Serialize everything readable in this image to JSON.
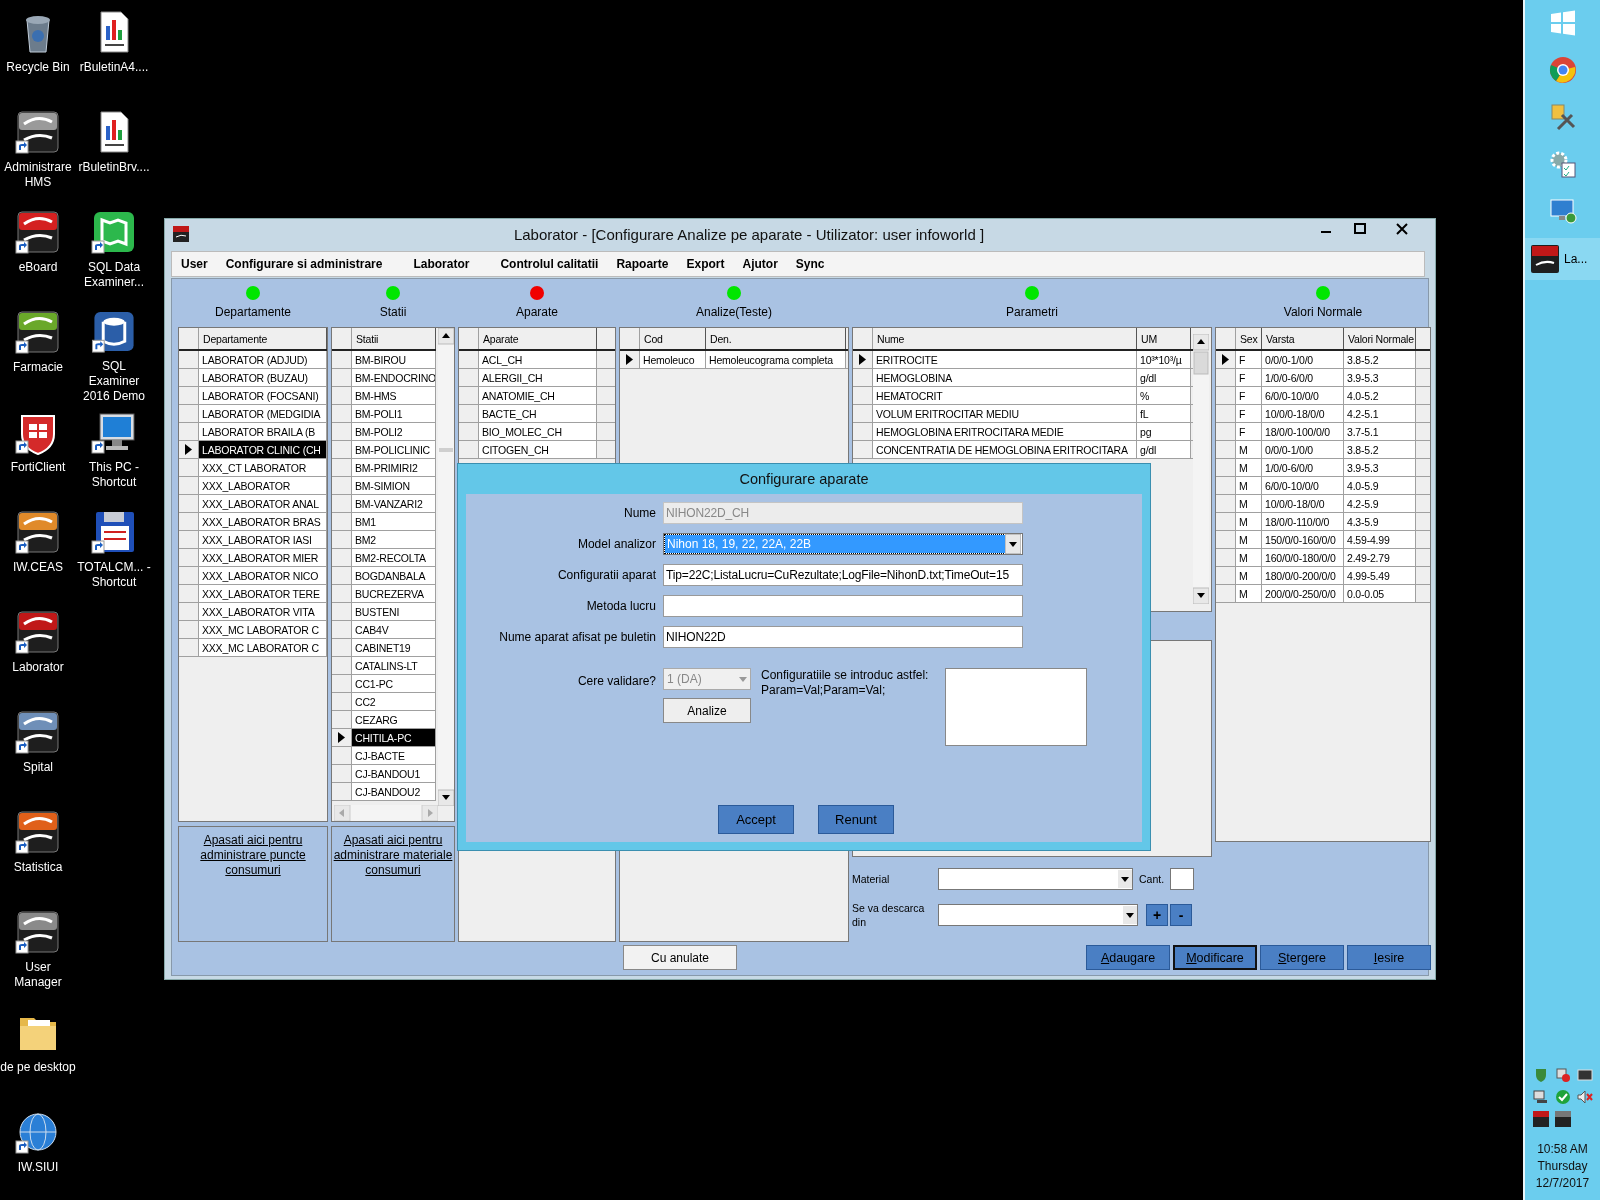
{
  "desktop": {
    "icons_column_1": [
      {
        "label": "Recycle Bin",
        "kind": "recycle",
        "shortcut": false
      },
      {
        "label": "Administrare HMS",
        "kind": "infoworld",
        "color": "#9a9a9a",
        "shortcut": true
      },
      {
        "label": "eBoard",
        "kind": "infoworld",
        "color": "#d42020",
        "shortcut": true
      },
      {
        "label": "Farmacie",
        "kind": "infoworld",
        "color": "#6aa82a",
        "shortcut": true
      },
      {
        "label": "FortiClient",
        "kind": "forticlient",
        "shortcut": true
      },
      {
        "label": "IW.CEAS",
        "kind": "infoworld",
        "color": "#e08a2a",
        "shortcut": true
      },
      {
        "label": "Laborator",
        "kind": "infoworld",
        "color": "#c01818",
        "shortcut": true
      },
      {
        "label": "Spital",
        "kind": "infoworld",
        "color": "#6f8fb8",
        "shortcut": true
      },
      {
        "label": "Statistica",
        "kind": "infoworld",
        "color": "#e0601a",
        "shortcut": true
      },
      {
        "label": "User Manager",
        "kind": "infoworld",
        "color": "#8a8a8a",
        "shortcut": true
      },
      {
        "label": "de pe desktop",
        "kind": "folder",
        "shortcut": false
      },
      {
        "label": "IW.SIUI",
        "kind": "globe",
        "shortcut": true
      }
    ],
    "icons_column_2": [
      {
        "label": "rBuletinA4....",
        "kind": "document",
        "shortcut": false
      },
      {
        "label": "rBuletinBrv....",
        "kind": "document",
        "shortcut": false
      },
      {
        "label": "SQL Data Examiner...",
        "kind": "sql-data",
        "shortcut": true
      },
      {
        "label": "SQL Examiner 2016 Demo",
        "kind": "sql-examiner",
        "shortcut": true
      },
      {
        "label": "This PC - Shortcut",
        "kind": "pc",
        "shortcut": true
      },
      {
        "label": "TOTALCM... - Shortcut",
        "kind": "floppy",
        "shortcut": true
      }
    ]
  },
  "window": {
    "title": "Laborator - [Configurare Analize pe aparate - Utilizator: user infoworld ]",
    "menu": [
      "User",
      "Configurare si administrare",
      "Laborator",
      "Controlul calitatii",
      "Rapoarte",
      "Export",
      "Ajutor",
      "Sync"
    ],
    "sections": [
      {
        "label": "Departamente",
        "color": "#00e600"
      },
      {
        "label": "Statii",
        "color": "#00e600"
      },
      {
        "label": "Aparate",
        "color": "#f00000"
      },
      {
        "label": "Analize(Teste)",
        "color": "#00e600"
      },
      {
        "label": "Parametri",
        "color": "#00e600"
      },
      {
        "label": "Valori Normale",
        "color": "#00e600"
      }
    ],
    "departamente": {
      "columns": [
        "Departamente"
      ],
      "rows": [
        {
          "cells": [
            "LABORATOR (ADJUD)"
          ],
          "selected": false,
          "highlighted": false
        },
        {
          "cells": [
            "LABORATOR (BUZAU)"
          ],
          "selected": false,
          "highlighted": false
        },
        {
          "cells": [
            "LABORATOR (FOCSANI)"
          ],
          "selected": false,
          "highlighted": false
        },
        {
          "cells": [
            "LABORATOR (MEDGIDIA"
          ],
          "selected": false,
          "highlighted": false
        },
        {
          "cells": [
            "LABORATOR BRAILA (B"
          ],
          "selected": false,
          "highlighted": false
        },
        {
          "cells": [
            "LABORATOR CLINIC (CH"
          ],
          "selected": true,
          "highlighted": true
        },
        {
          "cells": [
            "XXX_CT LABORATOR"
          ],
          "selected": false,
          "highlighted": false
        },
        {
          "cells": [
            "XXX_LABORATOR"
          ],
          "selected": false,
          "highlighted": false
        },
        {
          "cells": [
            "XXX_LABORATOR ANAL"
          ],
          "selected": false,
          "highlighted": false
        },
        {
          "cells": [
            "XXX_LABORATOR BRAS"
          ],
          "selected": false,
          "highlighted": false
        },
        {
          "cells": [
            "XXX_LABORATOR IASI"
          ],
          "selected": false,
          "highlighted": false
        },
        {
          "cells": [
            "XXX_LABORATOR MIER"
          ],
          "selected": false,
          "highlighted": false
        },
        {
          "cells": [
            "XXX_LABORATOR NICO"
          ],
          "selected": false,
          "highlighted": false
        },
        {
          "cells": [
            "XXX_LABORATOR TERE"
          ],
          "selected": false,
          "highlighted": false
        },
        {
          "cells": [
            "XXX_LABORATOR VITA"
          ],
          "selected": false,
          "highlighted": false
        },
        {
          "cells": [
            "XXX_MC LABORATOR C"
          ],
          "selected": false,
          "highlighted": false
        },
        {
          "cells": [
            "XXX_MC LABORATOR C"
          ],
          "selected": false,
          "highlighted": false
        }
      ]
    },
    "departamente_link": "Apasati aici pentru administrare puncte consumuri",
    "statii": {
      "columns": [
        "Statii"
      ],
      "rows": [
        {
          "cells": [
            "BM-BIROU"
          ],
          "selected": false,
          "highlighted": false
        },
        {
          "cells": [
            "BM-ENDOCRINO"
          ],
          "selected": false,
          "highlighted": false
        },
        {
          "cells": [
            "BM-HMS"
          ],
          "selected": false,
          "highlighted": false
        },
        {
          "cells": [
            "BM-POLI1"
          ],
          "selected": false,
          "highlighted": false
        },
        {
          "cells": [
            "BM-POLI2"
          ],
          "selected": false,
          "highlighted": false
        },
        {
          "cells": [
            "BM-POLICLINIC"
          ],
          "selected": false,
          "highlighted": false
        },
        {
          "cells": [
            "BM-PRIMIRI2"
          ],
          "selected": false,
          "highlighted": false
        },
        {
          "cells": [
            "BM-SIMION"
          ],
          "selected": false,
          "highlighted": false
        },
        {
          "cells": [
            "BM-VANZARI2"
          ],
          "selected": false,
          "highlighted": false
        },
        {
          "cells": [
            "BM1"
          ],
          "selected": false,
          "highlighted": false
        },
        {
          "cells": [
            "BM2"
          ],
          "selected": false,
          "highlighted": false
        },
        {
          "cells": [
            "BM2-RECOLTA"
          ],
          "selected": false,
          "highlighted": false
        },
        {
          "cells": [
            "BOGDANBALA"
          ],
          "selected": false,
          "highlighted": false
        },
        {
          "cells": [
            "BUCREZERVA"
          ],
          "selected": false,
          "highlighted": false
        },
        {
          "cells": [
            "BUSTENI"
          ],
          "selected": false,
          "highlighted": false
        },
        {
          "cells": [
            "CAB4V"
          ],
          "selected": false,
          "highlighted": false
        },
        {
          "cells": [
            "CABINET19"
          ],
          "selected": false,
          "highlighted": false
        },
        {
          "cells": [
            "CATALINS-LT"
          ],
          "selected": false,
          "highlighted": false
        },
        {
          "cells": [
            "CC1-PC"
          ],
          "selected": false,
          "highlighted": false
        },
        {
          "cells": [
            "CC2"
          ],
          "selected": false,
          "highlighted": false
        },
        {
          "cells": [
            "CEZARG"
          ],
          "selected": false,
          "highlighted": false
        },
        {
          "cells": [
            "CHITILA-PC"
          ],
          "selected": true,
          "highlighted": true
        },
        {
          "cells": [
            "CJ-BACTE"
          ],
          "selected": false,
          "highlighted": false
        },
        {
          "cells": [
            "CJ-BANDOU1"
          ],
          "selected": false,
          "highlighted": false
        },
        {
          "cells": [
            "CJ-BANDOU2"
          ],
          "selected": false,
          "highlighted": false
        }
      ]
    },
    "statii_link": "Apasati aici pentru administrare materiale consumuri",
    "aparate": {
      "columns": [
        "Aparate"
      ],
      "rows": [
        {
          "cells": [
            "ACL_CH"
          ],
          "selected": false
        },
        {
          "cells": [
            "ALERGII_CH"
          ],
          "selected": false
        },
        {
          "cells": [
            "ANATOMIE_CH"
          ],
          "selected": false
        },
        {
          "cells": [
            "BACTE_CH"
          ],
          "selected": false
        },
        {
          "cells": [
            "BIO_MOLEC_CH"
          ],
          "selected": false
        },
        {
          "cells": [
            "CITOGEN_CH"
          ],
          "selected": false
        }
      ]
    },
    "analize": {
      "columns": [
        "Cod",
        "Den."
      ],
      "rows": [
        {
          "cells": [
            "Hemoleuco",
            "Hemoleucograma completa"
          ],
          "selected": true
        }
      ]
    },
    "parametri": {
      "columns": [
        "Nume",
        "UM"
      ],
      "rows": [
        {
          "cells": [
            "ERITROCITE",
            "10³*10³/µ"
          ],
          "selected": true
        },
        {
          "cells": [
            "HEMOGLOBINA",
            "g/dl"
          ],
          "selected": false
        },
        {
          "cells": [
            "HEMATOCRIT",
            "%"
          ],
          "selected": false
        },
        {
          "cells": [
            "VOLUM ERITROCITAR MEDIU",
            "fL"
          ],
          "selected": false
        },
        {
          "cells": [
            "HEMOGLOBINA ERITROCITARA MEDIE",
            "pg"
          ],
          "selected": false
        },
        {
          "cells": [
            "CONCENTRATIA DE HEMOGLOBINA ERITROCITARA",
            "g/dl"
          ],
          "selected": false
        }
      ]
    },
    "valori": {
      "columns": [
        "Sex",
        "Varsta",
        "Valori Normale"
      ],
      "rows": [
        {
          "cells": [
            "F",
            "0/0/0-1/0/0",
            "3.8-5.2"
          ],
          "selected": true
        },
        {
          "cells": [
            "F",
            "1/0/0-6/0/0",
            "3.9-5.3"
          ],
          "selected": false
        },
        {
          "cells": [
            "F",
            "6/0/0-10/0/0",
            "4.0-5.2"
          ],
          "selected": false
        },
        {
          "cells": [
            "F",
            "10/0/0-18/0/0",
            "4.2-5.1"
          ],
          "selected": false
        },
        {
          "cells": [
            "F",
            "18/0/0-100/0/0",
            "3.7-5.1"
          ],
          "selected": false
        },
        {
          "cells": [
            "M",
            "0/0/0-1/0/0",
            "3.8-5.2"
          ],
          "selected": false
        },
        {
          "cells": [
            "M",
            "1/0/0-6/0/0",
            "3.9-5.3"
          ],
          "selected": false
        },
        {
          "cells": [
            "M",
            "6/0/0-10/0/0",
            "4.0-5.9"
          ],
          "selected": false
        },
        {
          "cells": [
            "M",
            "10/0/0-18/0/0",
            "4.2-5.9"
          ],
          "selected": false
        },
        {
          "cells": [
            "M",
            "18/0/0-110/0/0",
            "4.3-5.9"
          ],
          "selected": false
        },
        {
          "cells": [
            "M",
            "150/0/0-160/0/0",
            "4.59-4.99"
          ],
          "selected": false
        },
        {
          "cells": [
            "M",
            "160/0/0-180/0/0",
            "2.49-2.79"
          ],
          "selected": false
        },
        {
          "cells": [
            "M",
            "180/0/0-200/0/0",
            "4.99-5.49"
          ],
          "selected": false
        },
        {
          "cells": [
            "M",
            "200/0/0-250/0/0",
            "0.0-0.05"
          ],
          "selected": false
        }
      ]
    },
    "consum": {
      "material_label": "Material",
      "cant_label": "Cant.",
      "descarca_label": "Se va descarca din",
      "plus": "+",
      "minus": "-"
    },
    "cu_anulate": "Cu anulate",
    "actions": [
      {
        "label": "Adaugare",
        "focused": false
      },
      {
        "label": "Modificare",
        "focused": true
      },
      {
        "label": "Stergere",
        "focused": false
      },
      {
        "label": "Iesire",
        "focused": false
      }
    ]
  },
  "dialog": {
    "title": "Configurare aparate",
    "fields": [
      {
        "label": "Nume",
        "kind": "text",
        "value": "NIHON22D_CH",
        "disabled": true
      },
      {
        "label": "Model analizor",
        "kind": "combo",
        "value": "Nihon 18, 19, 22, 22A, 22B",
        "disabled": false
      },
      {
        "label": "Configuratii aparat",
        "kind": "text",
        "value": "Tip=22C;ListaLucru=CuRezultate;LogFile=NihonD.txt;TimeOut=15",
        "disabled": false
      },
      {
        "label": "Metoda lucru",
        "kind": "text",
        "disabled": false
      },
      {
        "label": "Nume aparat afisat pe buletin",
        "kind": "text",
        "value": "NIHON22D",
        "disabled": false
      }
    ],
    "cere_validare": {
      "label": "Cere validare?",
      "value": "1 (DA)",
      "disabled": true
    },
    "analize_button": "Analize",
    "note": "Configuratiile se introduc astfel:\nParam=Val;Param=Val;",
    "buttons": [
      "Accept",
      "Renunt"
    ]
  },
  "taskbar": {
    "app_button": "La...",
    "clock": {
      "time": "10:58 AM",
      "day": "Thursday",
      "date": "12/7/2017"
    }
  }
}
